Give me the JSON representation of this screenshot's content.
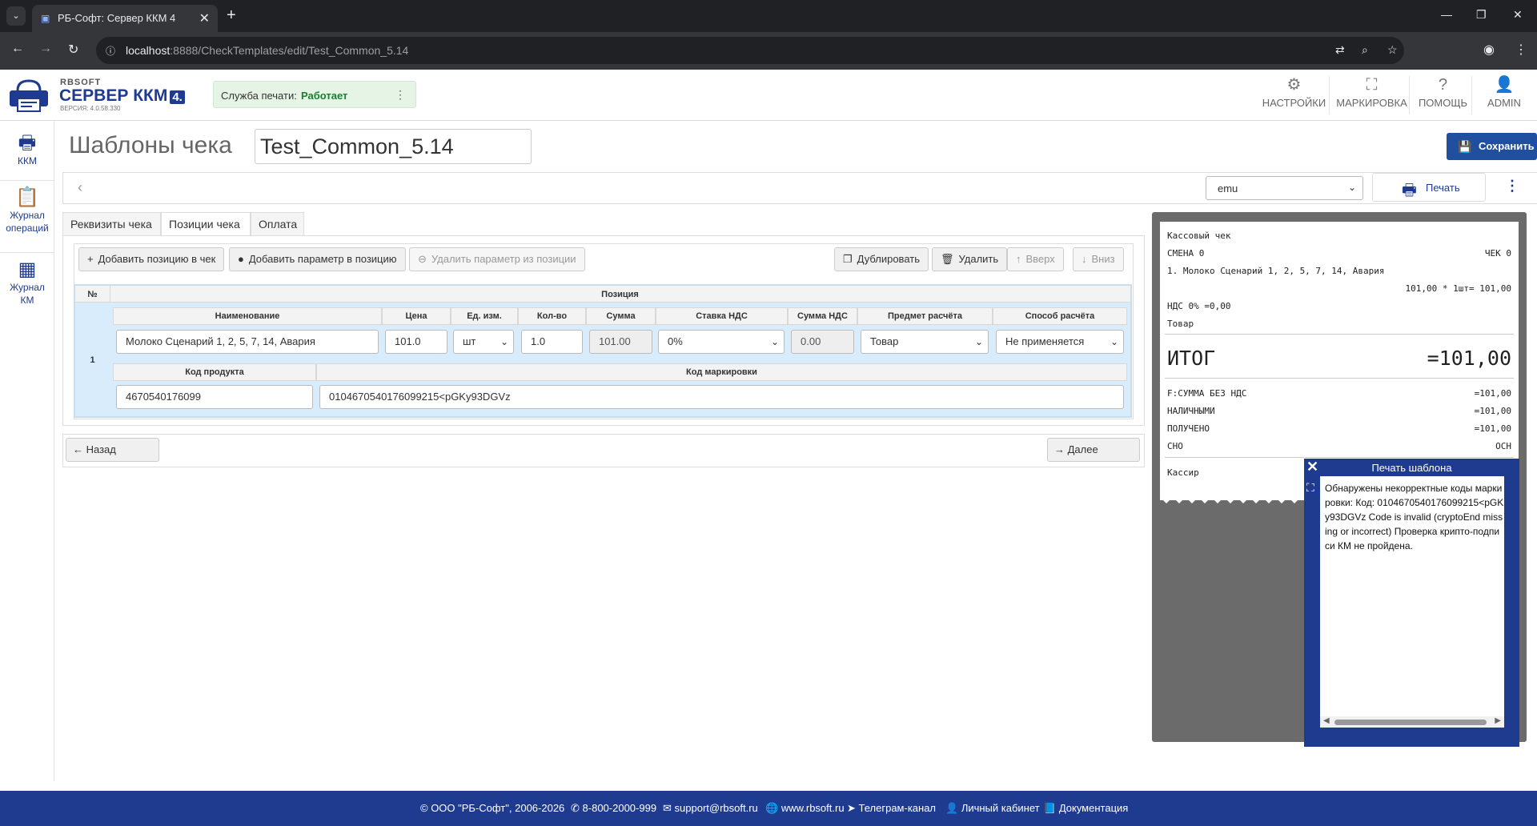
{
  "browser": {
    "tab_title": "РБ-Софт: Сервер ККМ 4",
    "url_host": "localhost",
    "url_rest": ":8888/CheckTemplates/edit/Test_Common_5.14"
  },
  "header": {
    "brand_small": "RBSOFT",
    "brand_big": "СЕРВЕР ККМ",
    "brand_ver": "4.",
    "version": "ВЕРСИЯ: 4.0.58.330",
    "print_service_label": "Служба печати:",
    "print_service_status": "Работает",
    "nav": [
      {
        "label": "НАСТРОЙКИ"
      },
      {
        "label": "МАРКИРОВКА"
      },
      {
        "label": "ПОМОЩЬ"
      },
      {
        "label": "ADMIN"
      }
    ]
  },
  "sidebar": {
    "items": [
      {
        "label": "ККМ"
      },
      {
        "label": "Журнал операций"
      },
      {
        "label": "Журнал КМ"
      }
    ]
  },
  "page": {
    "title": "Шаблоны чека",
    "template_name": "Test_Common_5.14",
    "save_label": "Сохранить",
    "printer_value": "emu",
    "print_label": "Печать",
    "tabs": [
      "Реквизиты чека",
      "Позиции чека",
      "Оплата"
    ],
    "active_tab": "Позиции чека"
  },
  "actions": {
    "add_position": "Добавить позицию в чек",
    "add_param": "Добавить параметр в позицию",
    "remove_param": "Удалить параметр из позиции",
    "duplicate": "Дублировать",
    "delete": "Удалить",
    "up": "Вверх",
    "down": "Вниз"
  },
  "grid": {
    "col_num": "№",
    "col_position": "Позиция",
    "headers": [
      "Наименование",
      "Цена",
      "Ед. изм.",
      "Кол-во",
      "Сумма",
      "Ставка НДС",
      "Сумма НДС",
      "Предмет расчёта",
      "Способ расчёта"
    ],
    "headers2": [
      "Код продукта",
      "Код маркировки"
    ],
    "row": {
      "num": "1",
      "name": "Молоко Сценарий 1, 2, 5, 7, 14, Авария",
      "price": "101.0",
      "unit": "шт",
      "qty": "1.0",
      "sum": "101.00",
      "vat_rate": "0%",
      "vat_sum": "0.00",
      "subject": "Товар",
      "method": "Не применяется",
      "product_code": "4670540176099",
      "marking_code": "0104670540176099215<pGKy93DGVz"
    }
  },
  "nav": {
    "back": "Назад",
    "next": "Далее"
  },
  "receipt": {
    "title": "Кассовый чек",
    "shift": "СМЕНА 0",
    "check": "ЧЕК 0",
    "item_line": "1. Молоко Сценарий 1, 2, 5, 7, 14, Авария",
    "item_calc": "101,00 * 1шт= 101,00",
    "vat": "НДС 0% =0,00",
    "subject": "Товар",
    "total_label": "ИТОГ",
    "total_value": "=101,00",
    "lines": [
      {
        "label": "F:СУММА БЕЗ НДС",
        "value": "=101,00"
      },
      {
        "label": "НАЛИЧНЫМИ",
        "value": "=101,00"
      },
      {
        "label": "ПОЛУЧЕНО",
        "value": "=101,00"
      },
      {
        "label": "СНО",
        "value": "ОСН"
      }
    ],
    "cashier": "Кассир"
  },
  "popup": {
    "title": "Печать шаблона",
    "message": "Обнаружены некорректные коды маркировки: Код: 0104670540176099215<pGKy93DGVz Code is invalid (cryptoEnd missing or incorrect) Проверка крипто-подписи КМ не пройдена."
  },
  "footer": {
    "copyright": "© ООО \"РБ-Софт\", 2006-2026",
    "phone": "8-800-2000-999",
    "email": "support@rbsoft.ru",
    "site": "www.rbsoft.ru",
    "telegram": "Телеграм-канал",
    "cabinet": "Личный кабинет",
    "docs": "Документация"
  }
}
